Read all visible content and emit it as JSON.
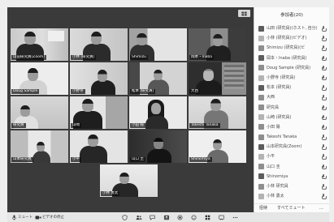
{
  "gallery": {
    "view_button_icon": "grid-icon",
    "tiles": [
      {
        "label": "山田研究員(Zoom)"
      },
      {
        "label": "小林 (研究員)"
      },
      {
        "label": "Shimizu"
      },
      {
        "label": "岡本・Inaba"
      },
      {
        "label": "Doug Sample"
      },
      {
        "label": "小野寺"
      },
      {
        "label": "松本 (研究員)"
      },
      {
        "label": "大西"
      },
      {
        "label": "研究員"
      },
      {
        "label": "山崎"
      },
      {
        "label": "小田 陽"
      },
      {
        "label": "Takeshi Tanaka"
      },
      {
        "label": "山本研究員"
      },
      {
        "label": "小平"
      },
      {
        "label": "山口 圭"
      },
      {
        "label": "Shinomiya"
      },
      {
        "label": "小林 勇太"
      }
    ]
  },
  "participants": {
    "title": "参加者(20)",
    "items": [
      {
        "name": "山田 (研究員)(ホスト, 自分)"
      },
      {
        "name": "小林 (研究員)(ビデオ)"
      },
      {
        "name": "Shimizu (研究員)(ビ"
      },
      {
        "name": "岡本・Inaba (研究員)"
      },
      {
        "name": "Doug Sample (研究員)"
      },
      {
        "name": "小野寺 (研究員)"
      },
      {
        "name": "松本 (研究員)"
      },
      {
        "name": "大西"
      },
      {
        "name": "研究員"
      },
      {
        "name": "山崎 (研究員)"
      },
      {
        "name": "小田 陽"
      },
      {
        "name": "Takeshi Tanaka"
      },
      {
        "name": "山本研究員(Zoom)"
      },
      {
        "name": "小平"
      },
      {
        "name": "山口 圭"
      },
      {
        "name": "Shinomiya"
      },
      {
        "name": "小林 研究員"
      },
      {
        "name": "小林 勇太"
      }
    ],
    "invite_label": "招待",
    "mute_all_label": "すべてミュート",
    "more_label": "…"
  },
  "toolbar": {
    "mute_label": "ミュート",
    "video_label": "ビデオの停止",
    "icons": [
      "security-icon",
      "participants-icon",
      "chat-icon",
      "share-screen-icon",
      "record-icon",
      "reactions-icon",
      "apps-icon",
      "whiteboard-icon",
      "more-icon"
    ]
  }
}
